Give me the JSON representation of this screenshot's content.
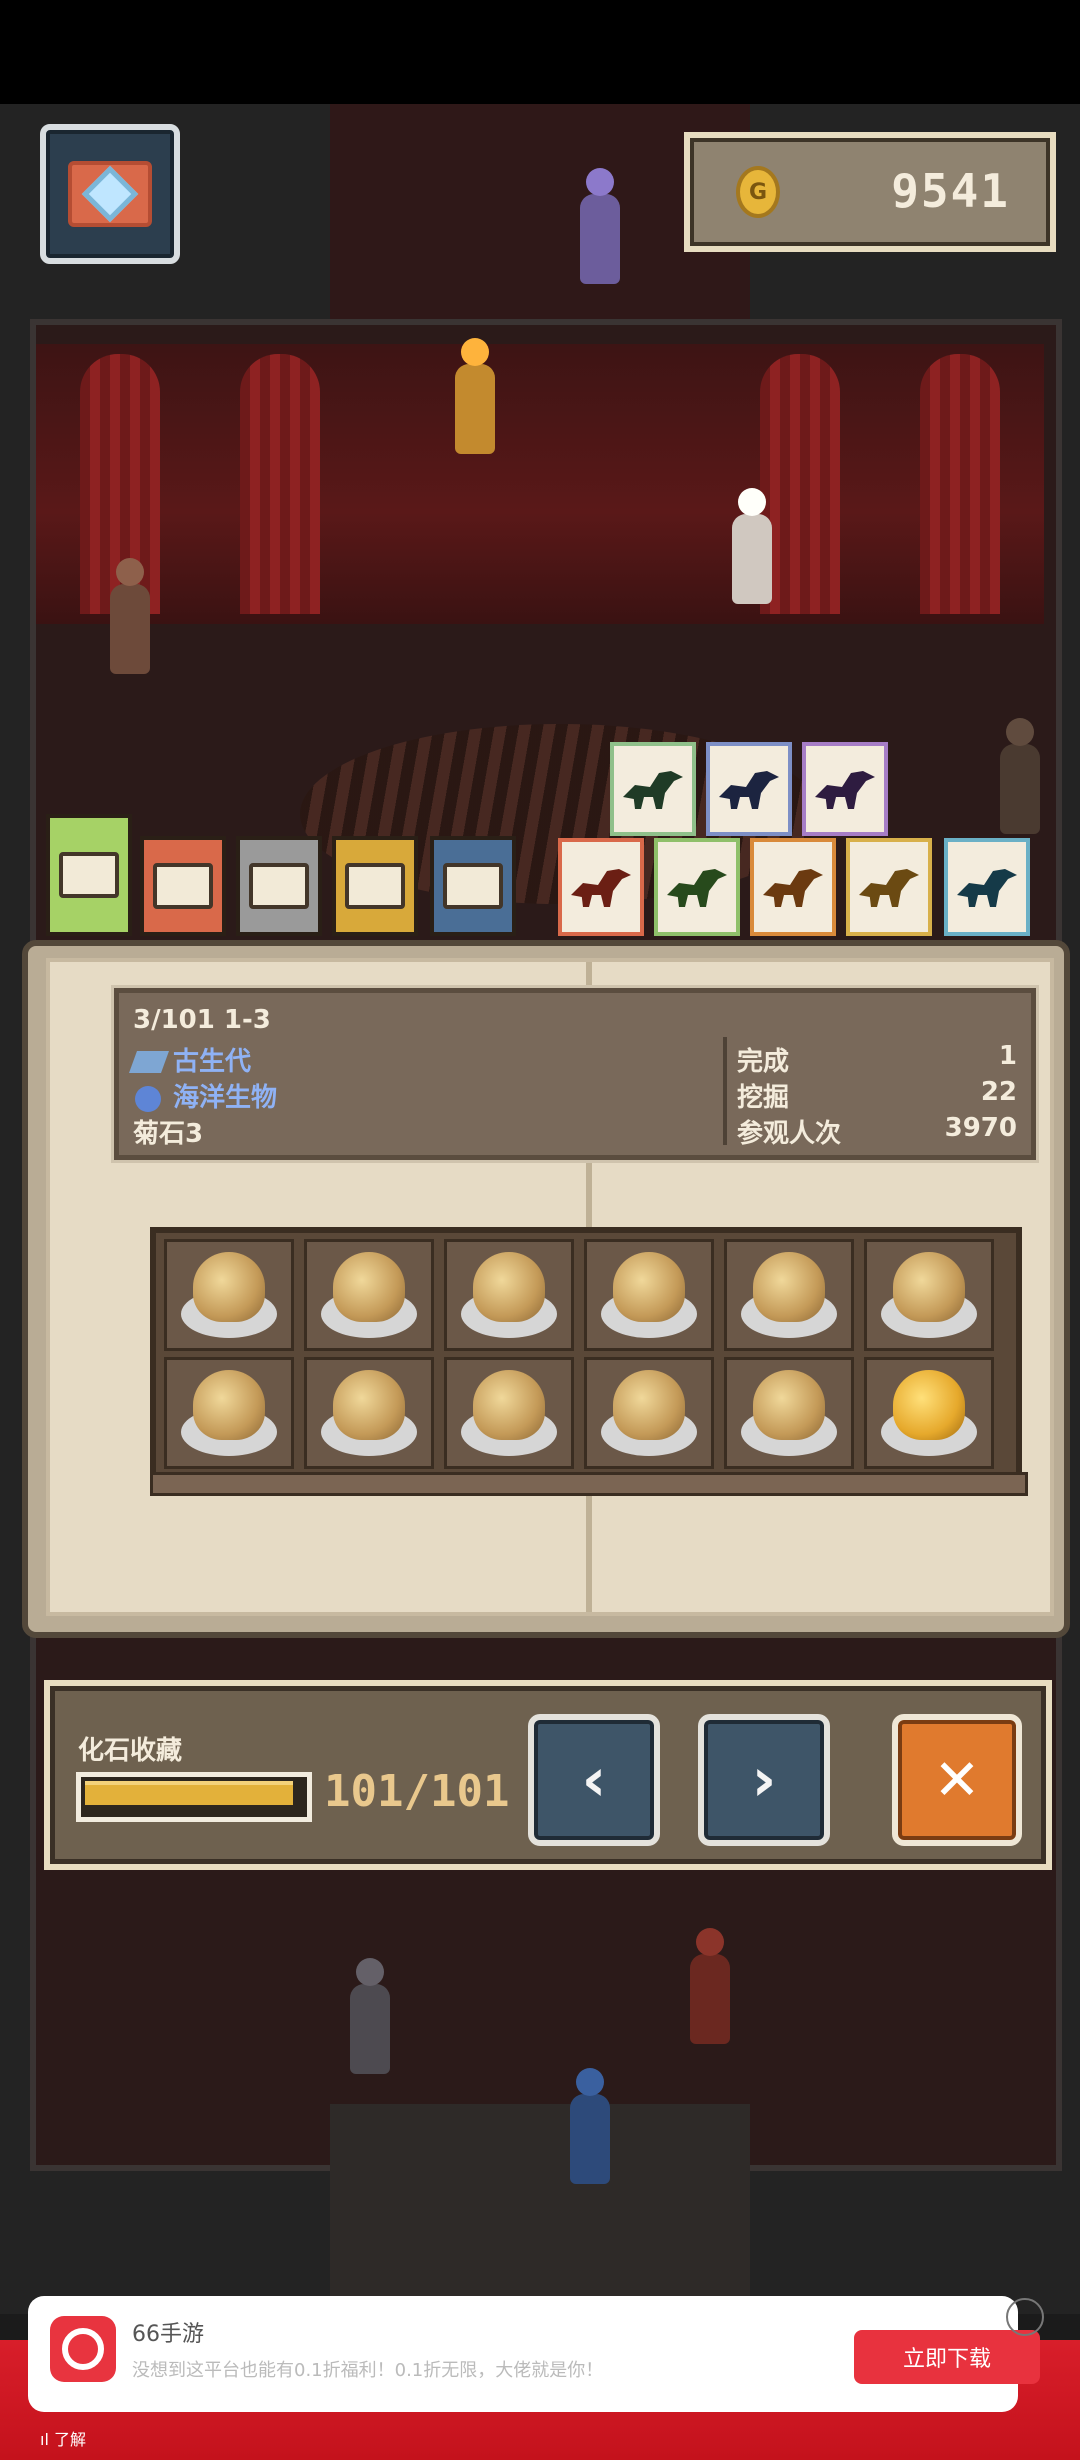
{
  "hud": {
    "coins": "9541",
    "camera_icon": "camera-icon",
    "coin_icon": "coin-icon",
    "coin_symbol": "G"
  },
  "tabs": {
    "dig_tabs": [
      {
        "name": "barrel-tab",
        "color": "#a6d266",
        "active": true
      },
      {
        "name": "red-tab",
        "color": "#d9694a"
      },
      {
        "name": "gray-tab",
        "color": "#9a9a9a"
      },
      {
        "name": "yellow-tab",
        "color": "#d8a93a"
      },
      {
        "name": "blue-tab",
        "color": "#4a6e96"
      }
    ],
    "dino_tabs_top": [
      {
        "name": "sauropod-tab",
        "color": "#8fc08a",
        "sil": "#1f3b26"
      },
      {
        "name": "longneck-tab",
        "color": "#7d8fc6",
        "sil": "#1c2440"
      },
      {
        "name": "mammoth-tab",
        "color": "#a67dc6",
        "sil": "#2e1c40"
      }
    ],
    "dino_tabs_bottom": [
      {
        "name": "trex-tab",
        "color": "#d9694a",
        "sil": "#6b1f14"
      },
      {
        "name": "raptor-tab",
        "color": "#8fc06a",
        "sil": "#274a1c"
      },
      {
        "name": "stego-tab",
        "color": "#d98a3a",
        "sil": "#6b3a10"
      },
      {
        "name": "ptero-tab",
        "color": "#d8b04a",
        "sil": "#6b4a12"
      },
      {
        "name": "plant-tab",
        "color": "#6ab0c6",
        "sil": "#153a48"
      }
    ]
  },
  "info": {
    "index": "3/101 1-3",
    "era": "古生代",
    "category": "海洋生物",
    "name": "菊石3",
    "stats": [
      {
        "label": "完成",
        "value": "1"
      },
      {
        "label": "挖掘",
        "value": "22"
      },
      {
        "label": "参观人次",
        "value": "3970"
      }
    ]
  },
  "fossils": [
    {
      "kind": "ammonite"
    },
    {
      "kind": "shell"
    },
    {
      "kind": "spire"
    },
    {
      "kind": "coil"
    },
    {
      "kind": "tower"
    },
    {
      "kind": "clump"
    },
    {
      "kind": "knob"
    },
    {
      "kind": "spiral"
    },
    {
      "kind": "ridge"
    },
    {
      "kind": "twist"
    },
    {
      "kind": "stack"
    },
    {
      "kind": "gold-ammonite",
      "gold": true
    }
  ],
  "collection": {
    "label": "化石收藏",
    "count": "101/101",
    "progress": 1.0,
    "prev_label": "‹",
    "next_label": "›",
    "close_label": "✕"
  },
  "ad": {
    "app_name": "66手游",
    "description": "没想到这平台也能有0.1折福利！0.1折无限，大佬就是你！",
    "cta": "立即下载",
    "footer": "ıl 了解"
  }
}
